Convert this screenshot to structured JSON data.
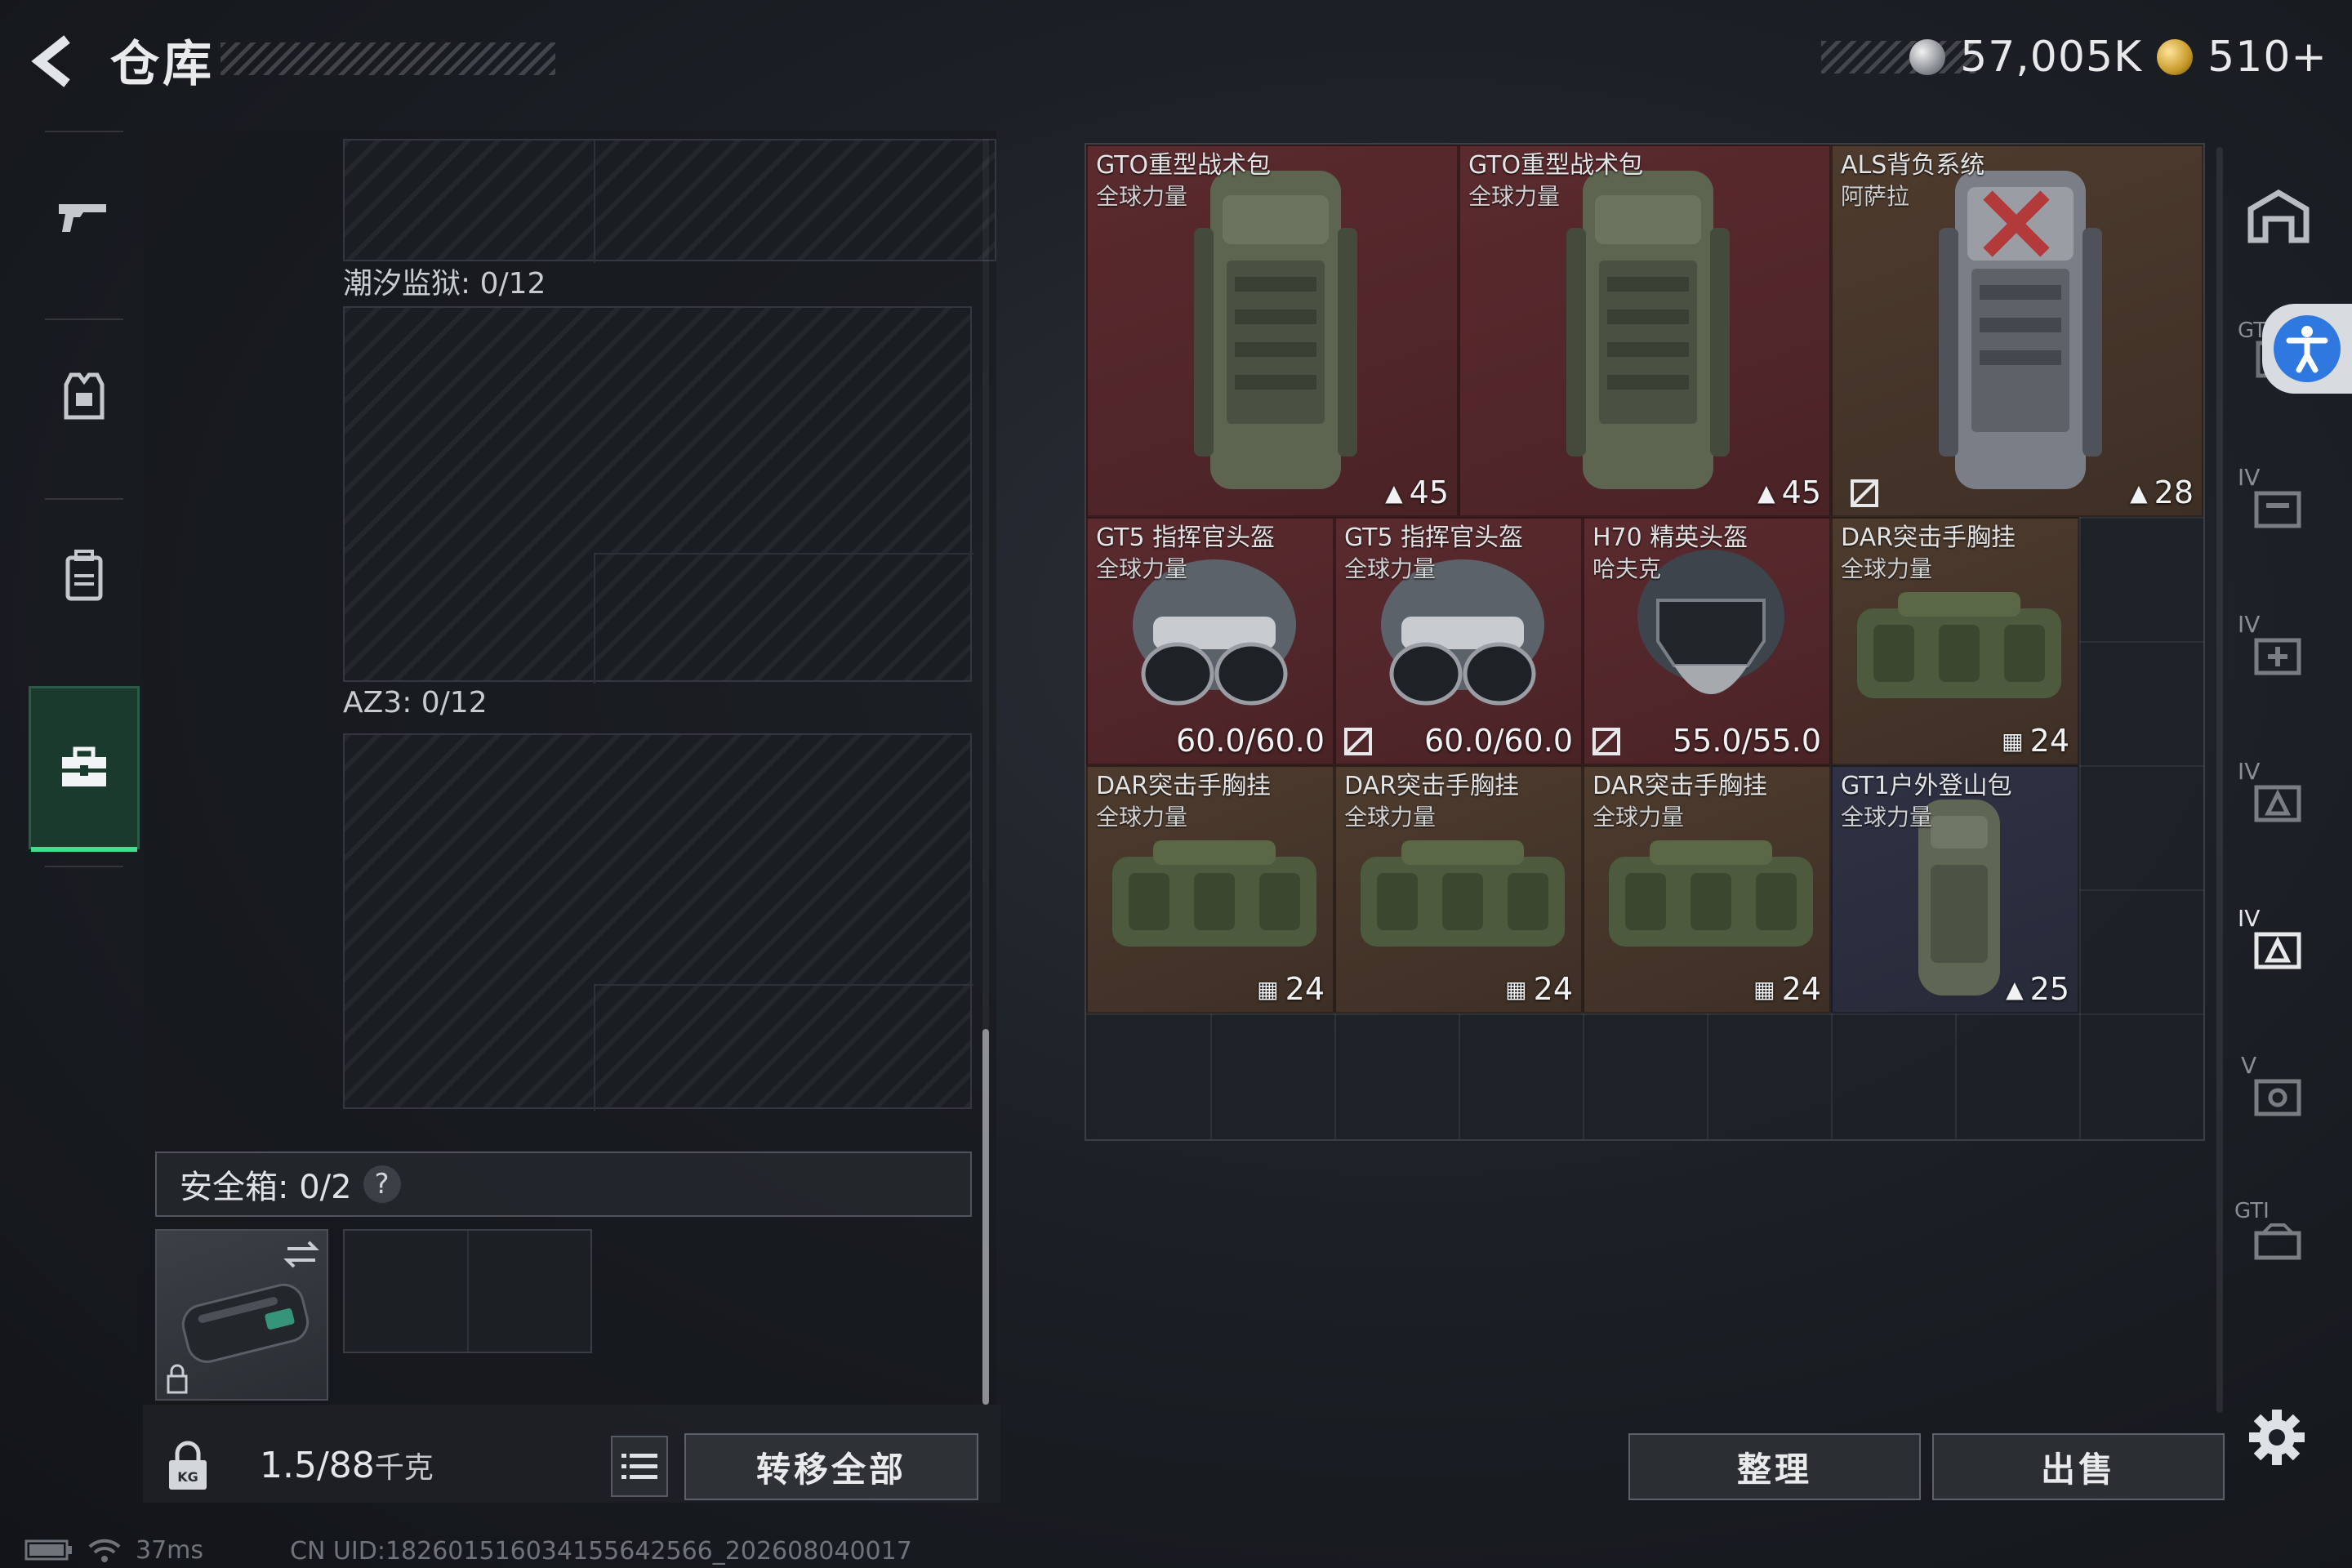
{
  "header": {
    "title": "仓库",
    "currency_silver": "57,005K",
    "currency_gold": "510+"
  },
  "left_rail": {
    "items": [
      {
        "icon": "gun-icon"
      },
      {
        "icon": "armor-vest-icon"
      },
      {
        "icon": "backpack-icon"
      },
      {
        "icon": "toolbox-icon"
      }
    ]
  },
  "storage": {
    "section1_label": "潮汐监狱: 0/12",
    "section2_label": "AZ3: 0/12",
    "safe_box_label": "安全箱: 0/2",
    "safe_help": "?",
    "weight_value": "1.5/88",
    "weight_unit": "千克",
    "transfer_all": "转移全部"
  },
  "items": [
    {
      "name": "GTO重型战术包",
      "sub": "全球力量",
      "stat": "45",
      "stat_icon": "backpack-icon",
      "rarity": "red",
      "icon": "backpack-icon"
    },
    {
      "name": "GTO重型战术包",
      "sub": "全球力量",
      "stat": "45",
      "stat_icon": "backpack-icon",
      "rarity": "red",
      "icon": "backpack-icon"
    },
    {
      "name": "ALS背负系统",
      "sub": "阿萨拉",
      "stat": "28",
      "stat_icon": "backpack-icon",
      "rarity": "gold",
      "icon": "backpack-icon"
    },
    {
      "name": "GT5 指挥官头盔",
      "sub": "全球力量",
      "stat": "60.0/60.0",
      "rarity": "red",
      "icon": "helmet-icon"
    },
    {
      "name": "GT5 指挥官头盔",
      "sub": "全球力量",
      "stat": "60.0/60.0",
      "rarity": "red",
      "icon": "helmet-icon"
    },
    {
      "name": "H70 精英头盔",
      "sub": "哈夫克",
      "stat": "55.0/55.0",
      "rarity": "red",
      "icon": "helmet-icon"
    },
    {
      "name": "DAR突击手胸挂",
      "sub": "全球力量",
      "stat": "24",
      "stat_icon": "chest-rig-icon",
      "rarity": "gold",
      "icon": "chest-rig-icon"
    },
    {
      "name": "DAR突击手胸挂",
      "sub": "全球力量",
      "stat": "24",
      "stat_icon": "chest-rig-icon",
      "rarity": "gold",
      "icon": "chest-rig-icon"
    },
    {
      "name": "DAR突击手胸挂",
      "sub": "全球力量",
      "stat": "24",
      "stat_icon": "chest-rig-icon",
      "rarity": "gold",
      "icon": "chest-rig-icon"
    },
    {
      "name": "DAR突击手胸挂",
      "sub": "全球力量",
      "stat": "24",
      "stat_icon": "chest-rig-icon",
      "rarity": "gold",
      "icon": "chest-rig-icon"
    },
    {
      "name": "GT1户外登山包",
      "sub": "全球力量",
      "stat": "25",
      "stat_icon": "backpack-icon",
      "rarity": "purple",
      "icon": "backpack-icon"
    }
  ],
  "right_rail": {
    "items": [
      {
        "label": "",
        "icon": "warehouse-icon"
      },
      {
        "label": "GT",
        "icon": "gear-storage-icon"
      },
      {
        "label": "IV",
        "icon": "storage-tier-icon"
      },
      {
        "label": "IV",
        "icon": "medical-storage-icon"
      },
      {
        "label": "IV",
        "icon": "ammo-storage-icon"
      },
      {
        "label": "IV",
        "icon": "armor-storage-icon"
      },
      {
        "label": "V",
        "icon": "gear-rack-icon"
      },
      {
        "label": "GTI",
        "icon": "workbench-icon"
      }
    ]
  },
  "buttons": {
    "sort": "整理",
    "sell": "出售"
  },
  "status": {
    "ping": "37ms",
    "uid": "CN UID:18260151603415564​2566_202608040017"
  },
  "colors": {
    "rarity_red": "#5a2a2e",
    "rarity_gold": "#4e3b2e",
    "rarity_purple": "#2f3244",
    "accent_green": "#3ee08e",
    "access_blue": "#2f78e0"
  }
}
